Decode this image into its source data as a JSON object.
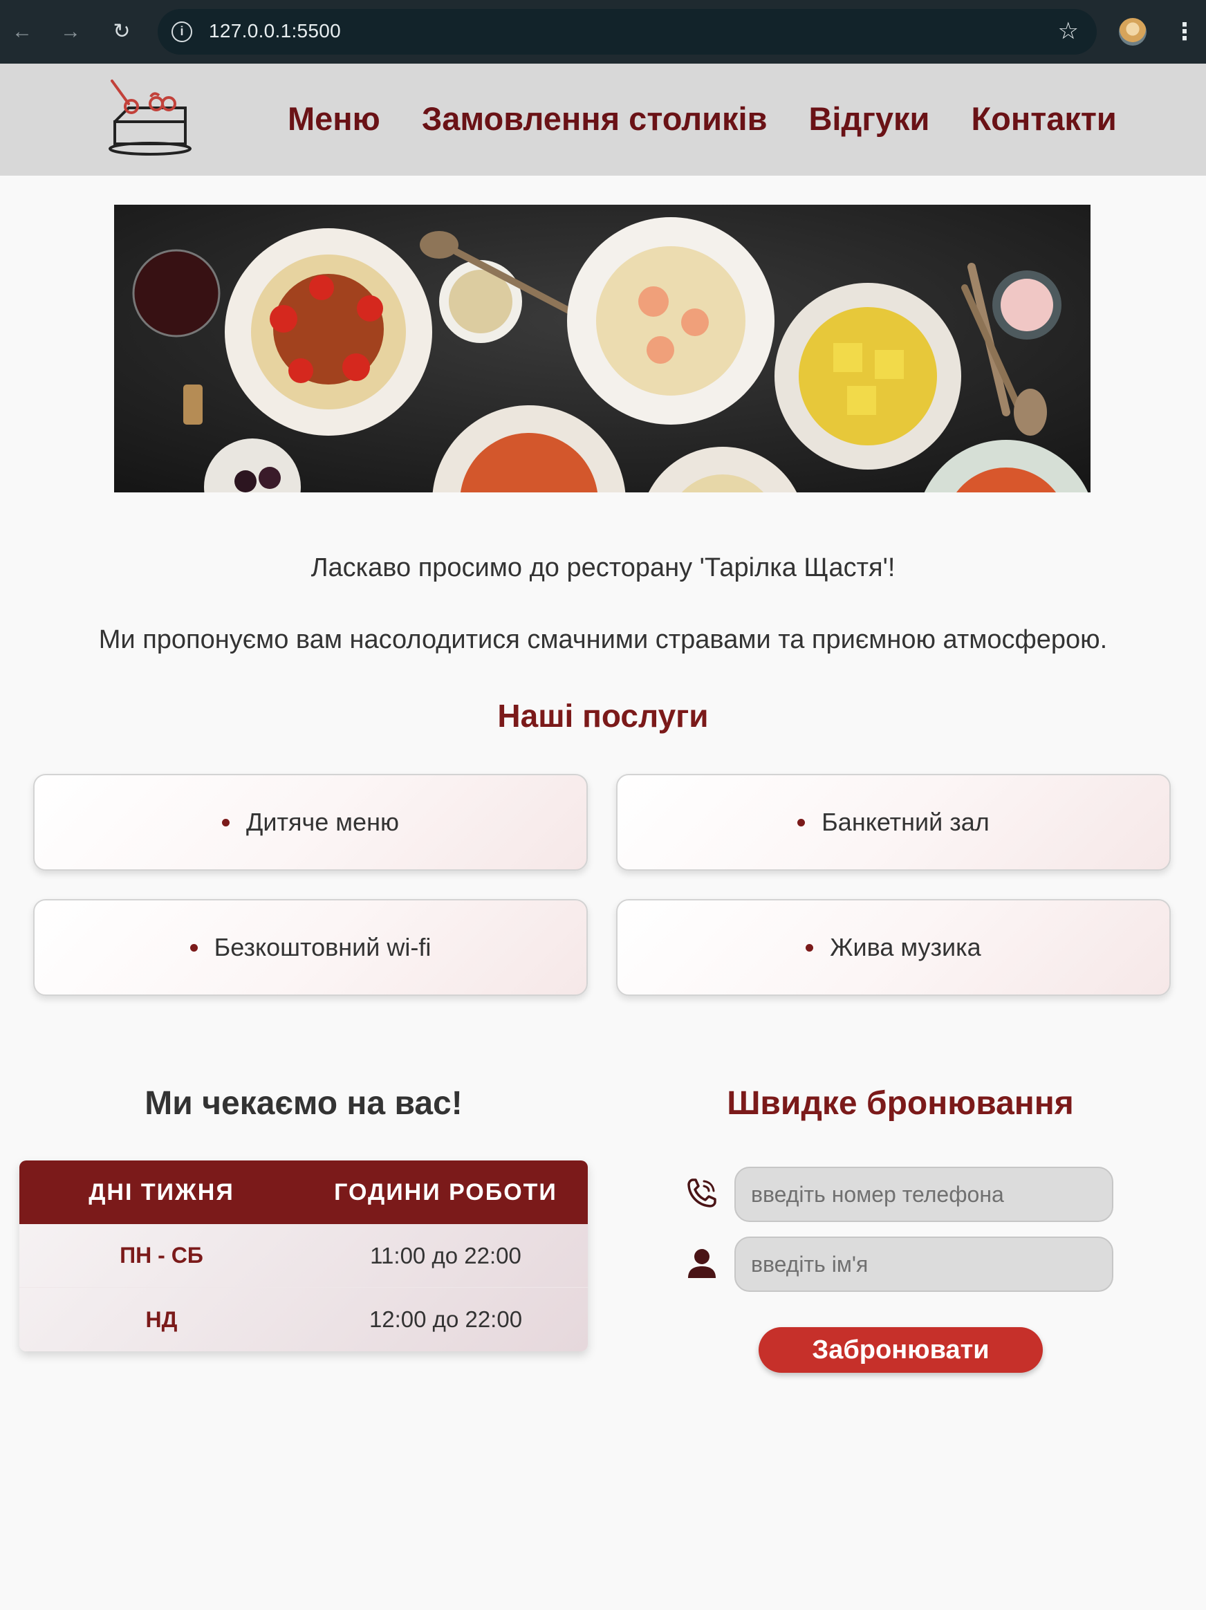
{
  "browser": {
    "url": "127.0.0.1:5500"
  },
  "nav": {
    "items": [
      {
        "label": "Меню"
      },
      {
        "label": "Замовлення столиків"
      },
      {
        "label": "Відгуки"
      },
      {
        "label": "Контакти"
      }
    ]
  },
  "welcome": {
    "line1": "Ласкаво просимо до ресторану 'Тарілка Щастя'!",
    "line2": "Ми пропонуємо вам насолодитися смачними стравами та приємною атмосферою."
  },
  "services": {
    "title": "Наші послуги",
    "items": [
      {
        "label": "Дитяче меню"
      },
      {
        "label": "Банкетний зал"
      },
      {
        "label": "Безкоштовний wi-fi"
      },
      {
        "label": "Жива музика"
      }
    ]
  },
  "hours": {
    "title": "Ми чекаємо на вас!",
    "headers": [
      "ДНІ ТИЖНЯ",
      "ГОДИНИ РОБОТИ"
    ],
    "rows": [
      {
        "day": "ПН - СБ",
        "time": "11:00 до 22:00"
      },
      {
        "day": "НД",
        "time": "12:00 до 22:00"
      }
    ]
  },
  "booking": {
    "title": "Швидке бронювання",
    "phone_placeholder": "введіть номер телефона",
    "name_placeholder": "введіть ім'я",
    "submit_label": "Забронювати"
  },
  "colors": {
    "brand": "#7b1a1a",
    "button": "#c6302a",
    "header_bg": "#d8d8d8"
  },
  "icons": [
    "back-arrow-icon",
    "forward-arrow-icon",
    "reload-icon",
    "info-icon",
    "star-icon",
    "profile-avatar-icon",
    "menu-kebab-icon",
    "cake-logo-icon",
    "phone-icon",
    "user-icon"
  ]
}
